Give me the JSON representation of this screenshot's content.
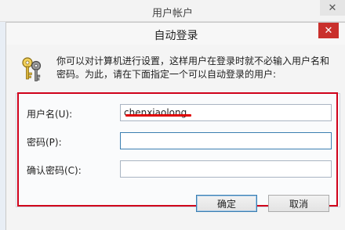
{
  "parent_window": {
    "title": "用户帐户",
    "close_glyph": "✕"
  },
  "dialog": {
    "title": "自动登录",
    "close_glyph": "✕",
    "icon": "keys-icon",
    "description": "你可以对计算机进行设置，这样用户在登录时就不必输入用户名和密码。为此，请在下面指定一个可以自动登录的用户:",
    "fields": {
      "username": {
        "label": "用户名(U):",
        "value": "chenxiaolong"
      },
      "password": {
        "label": "密码(P):",
        "value": ""
      },
      "confirm_password": {
        "label": "确认密码(C):",
        "value": ""
      }
    },
    "buttons": {
      "ok": "确定",
      "cancel": "取消"
    }
  },
  "colors": {
    "highlight_box": "#d0021b",
    "close_button": "#c9302c"
  }
}
